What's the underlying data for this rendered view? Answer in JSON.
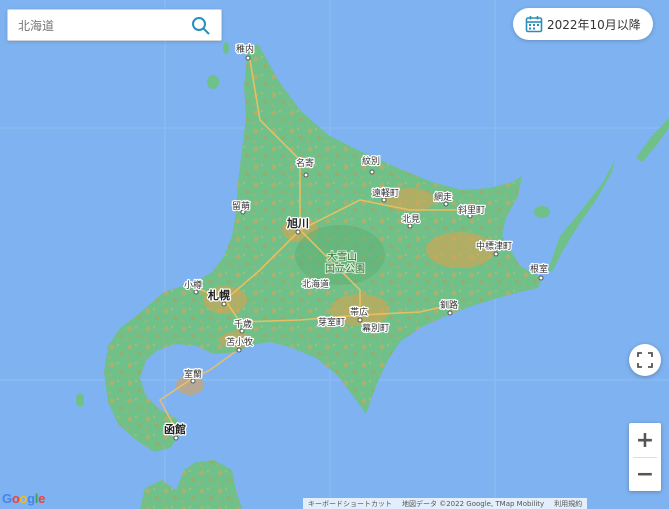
{
  "search": {
    "placeholder": "北海道"
  },
  "date_filter": {
    "label": "2022年10月以降"
  },
  "places": {
    "wakkanai": "稚内",
    "nayoro": "名寄",
    "monbetsu": "紋別",
    "engaru": "遠軽町",
    "abashiri": "網走",
    "shari": "斜里町",
    "rumoi": "留萌",
    "asahikawa": "旭川",
    "kitami": "北見",
    "nakashibetsu": "中標津町",
    "daisetsu_line1": "大雪山",
    "daisetsu_line2": "国立公園",
    "nemuro": "根室",
    "otaru": "小樽",
    "sapporo": "札幌",
    "hokkaido": "北海道",
    "obihiro": "帯広",
    "memuro": "芽室町",
    "makubetsu": "幕別町",
    "chitose": "千歳",
    "tomakomai": "苫小牧",
    "kushiro": "釧路",
    "muroran": "室蘭",
    "hakodate": "函館"
  },
  "attribution": {
    "shortcuts": "キーボードショートカット",
    "map_data": "地図データ ©2022 Google, TMap Mobility",
    "terms": "利用規約"
  },
  "logo": "Google",
  "controls": {
    "zoom_in": "+",
    "zoom_out": "−"
  },
  "colors": {
    "water": "#7fb2f0",
    "land": "#6fbf86",
    "urban": "#e2a14a"
  }
}
